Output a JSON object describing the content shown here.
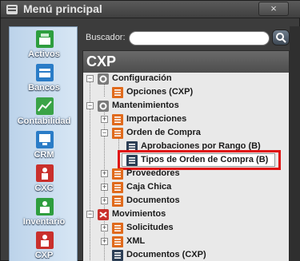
{
  "window": {
    "title": "Menú principal",
    "close_label": "×"
  },
  "rail": {
    "items": [
      {
        "label": "Activos",
        "icon": "cash-register-icon",
        "color": "#2e9e3e"
      },
      {
        "label": "Bancos",
        "icon": "bank-icon",
        "color": "#2a7cc7"
      },
      {
        "label": "Contabilidad",
        "icon": "chart-icon",
        "color": "#3aa347"
      },
      {
        "label": "CRM",
        "icon": "crm-icon",
        "color": "#2a7cc7"
      },
      {
        "label": "CXC",
        "icon": "cxc-icon",
        "color": "#c9302c"
      },
      {
        "label": "Inventario",
        "icon": "inventory-icon",
        "color": "#2e9e3e"
      },
      {
        "label": "CXP",
        "icon": "cxp-icon",
        "color": "#c9302c"
      }
    ]
  },
  "search": {
    "label": "Buscador:",
    "value": "",
    "placeholder": ""
  },
  "panel": {
    "heading": "CXP"
  },
  "tree": {
    "nodes": [
      {
        "label": "Configuración",
        "icon": "gear-icon"
      },
      {
        "label": "Opciones (CXP)",
        "icon": "list-icon"
      },
      {
        "label": "Mantenimientos",
        "icon": "gear-icon"
      },
      {
        "label": "Importaciones",
        "icon": "list-icon"
      },
      {
        "label": "Orden de Compra",
        "icon": "list-icon"
      },
      {
        "label": "Aprobaciones por Rango (B)",
        "icon": "list-icon"
      },
      {
        "label": "Tipos de Orden de Compra (B)",
        "icon": "list-icon"
      },
      {
        "label": "Proveedores",
        "icon": "list-icon"
      },
      {
        "label": "Caja Chica",
        "icon": "list-icon"
      },
      {
        "label": "Documentos",
        "icon": "list-icon"
      },
      {
        "label": "Movimientos",
        "icon": "move-icon"
      },
      {
        "label": "Solicitudes",
        "icon": "list-icon"
      },
      {
        "label": "XML",
        "icon": "list-icon"
      },
      {
        "label": "Documentos (CXP)",
        "icon": "list-icon"
      }
    ]
  },
  "colors": {
    "highlight": "#e01414",
    "accent_orange": "#e06a1c",
    "navy": "#2c3e55"
  }
}
